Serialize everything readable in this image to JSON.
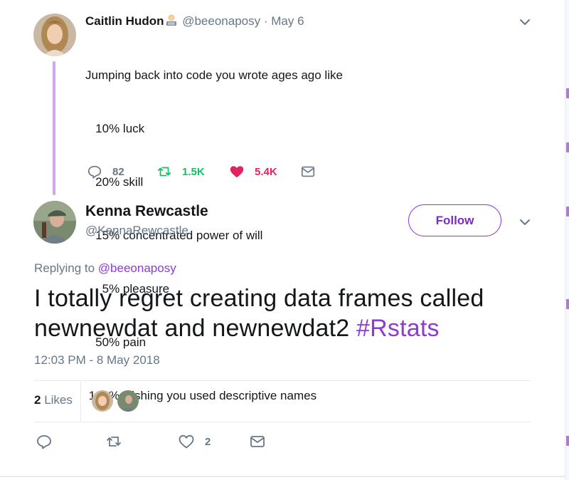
{
  "parent_tweet": {
    "name": "Caitlin Hudon",
    "handle": "@beeonaposy",
    "separator": "·",
    "date": "May 6",
    "lines": [
      "Jumping back into code you wrote ages ago like",
      "   10% luck",
      "   20% skill",
      "   15% concentrated power of will",
      "     5% pleasure",
      "   50% pain",
      " 100% wishing you used descriptive names"
    ],
    "replies": "82",
    "retweets": "1.5K",
    "likes": "5.4K"
  },
  "main_tweet": {
    "name": "Kenna Rewcastle",
    "handle": "@KennaRewcastle",
    "follow_label": "Follow",
    "replying_prefix": "Replying to",
    "replying_handle": "@beeonaposy",
    "text": "I totally regret creating data frames called newnewdat and newnewdat2",
    "hashtag": "#Rstats",
    "timestamp": "12:03 PM - 8 May 2018",
    "likes_count": "2",
    "likes_label": "Likes",
    "like_action_count": "2"
  },
  "colors": {
    "accent": "#8e3ad4",
    "retweet_green": "#17bf63",
    "like_red": "#e0245e",
    "muted": "#657786",
    "thread_line": "#d0a7ef"
  },
  "icons": {
    "reply": "reply-icon",
    "retweet": "retweet-icon",
    "like": "heart-icon",
    "dm": "envelope-icon",
    "more": "chevron-down-icon"
  }
}
